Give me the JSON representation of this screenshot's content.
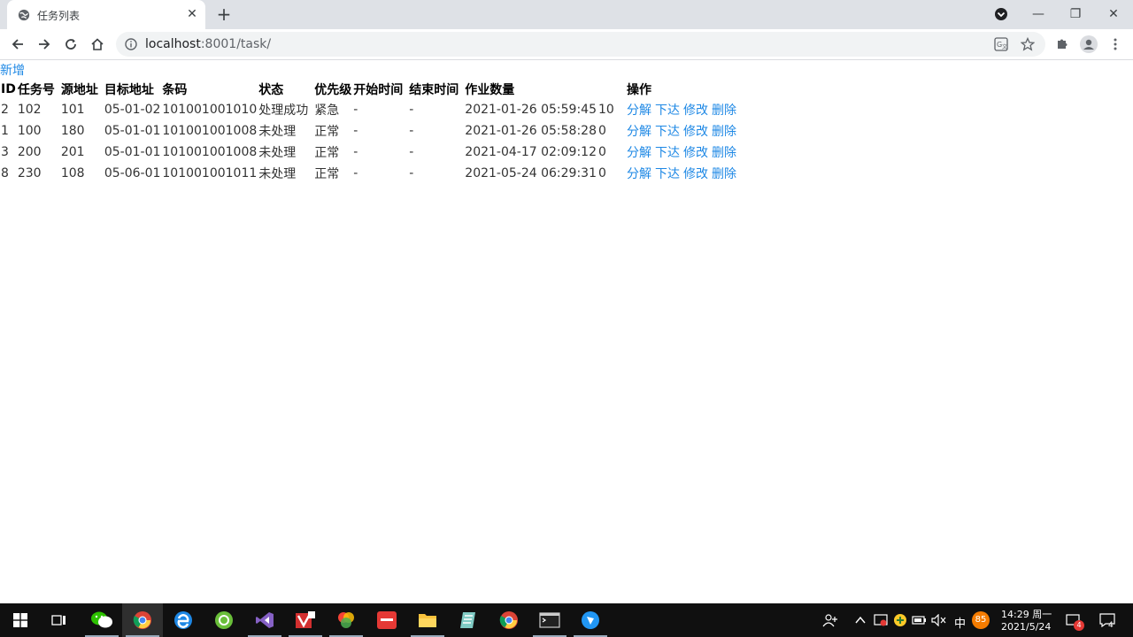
{
  "browser": {
    "tab_title": "任务列表",
    "url_host": "localhost",
    "url_rest": ":8001/task/"
  },
  "page": {
    "add_label": "新增",
    "headers": [
      "ID",
      "任务号",
      "源地址",
      "目标地址",
      "条码",
      "状态",
      "优先级",
      "开始时间",
      "结束时间",
      "作业数量",
      "",
      "操作"
    ],
    "rows": [
      {
        "id": "2",
        "task_no": "102",
        "src": "101",
        "dst": "05-01-02",
        "barcode": "101001001010",
        "status": "处理成功",
        "priority": "紧急",
        "start": "-",
        "end": "-",
        "created": "2021-01-26 05:59:45",
        "qty": "10"
      },
      {
        "id": "1",
        "task_no": "100",
        "src": "180",
        "dst": "05-01-01",
        "barcode": "101001001008",
        "status": "未处理",
        "priority": "正常",
        "start": "-",
        "end": "-",
        "created": "2021-01-26 05:58:28",
        "qty": "0"
      },
      {
        "id": "3",
        "task_no": "200",
        "src": "201",
        "dst": "05-01-01",
        "barcode": "101001001008",
        "status": "未处理",
        "priority": "正常",
        "start": "-",
        "end": "-",
        "created": "2021-04-17 02:09:12",
        "qty": "0"
      },
      {
        "id": "8",
        "task_no": "230",
        "src": "108",
        "dst": "05-06-01",
        "barcode": "101001001011",
        "status": "未处理",
        "priority": "正常",
        "start": "-",
        "end": "-",
        "created": "2021-05-24 06:29:31",
        "qty": "0"
      }
    ],
    "actions": [
      "分解",
      "下达",
      "修改",
      "删除"
    ]
  },
  "taskbar": {
    "time": "14:29 周一",
    "date": "2021/5/24",
    "ime": "中",
    "badge_notifications": "4",
    "badge_temp": "85",
    "badge_red": "4"
  }
}
